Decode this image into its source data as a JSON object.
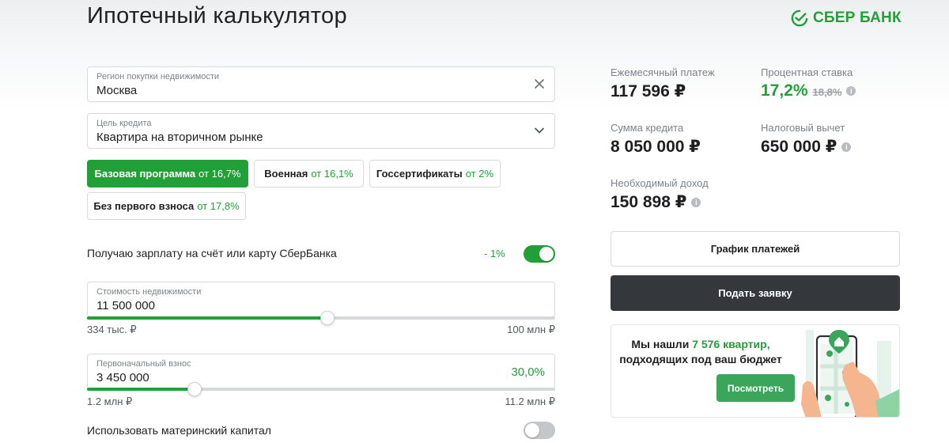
{
  "header": {
    "title": "Ипотечный калькулятор",
    "logo_text": "СБЕР БАНК",
    "brand_color": "#21a038"
  },
  "region": {
    "label": "Регион покупки недвижимости",
    "value": "Москва",
    "icon": "close-icon"
  },
  "purpose": {
    "label": "Цель кредита",
    "value": "Квартира на вторичном рынке",
    "icon": "chevron-down-icon"
  },
  "programs": [
    {
      "name": "Базовая программа",
      "from": "от 16,7%",
      "selected": true
    },
    {
      "name": "Военная",
      "from": "от 16,1%",
      "selected": false
    },
    {
      "name": "Госсертификаты",
      "from": "от 2%",
      "selected": false
    },
    {
      "name": "Без первого взноса",
      "from": "от 17,8%",
      "selected": false
    }
  ],
  "salary": {
    "label": "Получаю зарплату на счёт или карту СберБанка",
    "discount": "- 1%",
    "enabled": true
  },
  "property_cost": {
    "label": "Стоимость недвижимости",
    "value": "11 500 000",
    "min_label": "334 тыс. ₽",
    "max_label": "100 млн ₽",
    "slider_fraction": 0.513
  },
  "down_payment": {
    "label": "Первоначальный взнос",
    "value": "3 450 000",
    "percent": "30,0%",
    "min_label": "1.2 млн ₽",
    "max_label": "11.2 млн ₽",
    "slider_fraction": 0.229
  },
  "maternity": {
    "label": "Использовать материнский капитал",
    "enabled": false
  },
  "results": {
    "monthly_label": "Ежемесячный платеж",
    "monthly_value": "117 596 ₽",
    "rate_label": "Процентная ставка",
    "rate_value": "17,2%",
    "rate_old": "18,8%",
    "loan_label": "Сумма кредита",
    "loan_value": "8 050 000 ₽",
    "tax_label": "Налоговый вычет",
    "tax_value": "650 000 ₽",
    "income_label": "Необходимый доход",
    "income_value": "150 898 ₽"
  },
  "buttons": {
    "schedule": "График платежей",
    "apply": "Подать заявку"
  },
  "promo": {
    "line1_prefix": "Мы нашли",
    "line1_highlight": "7 576 квартир,",
    "line2": "подходящих под ваш бюджет",
    "button": "Посмотреть"
  }
}
